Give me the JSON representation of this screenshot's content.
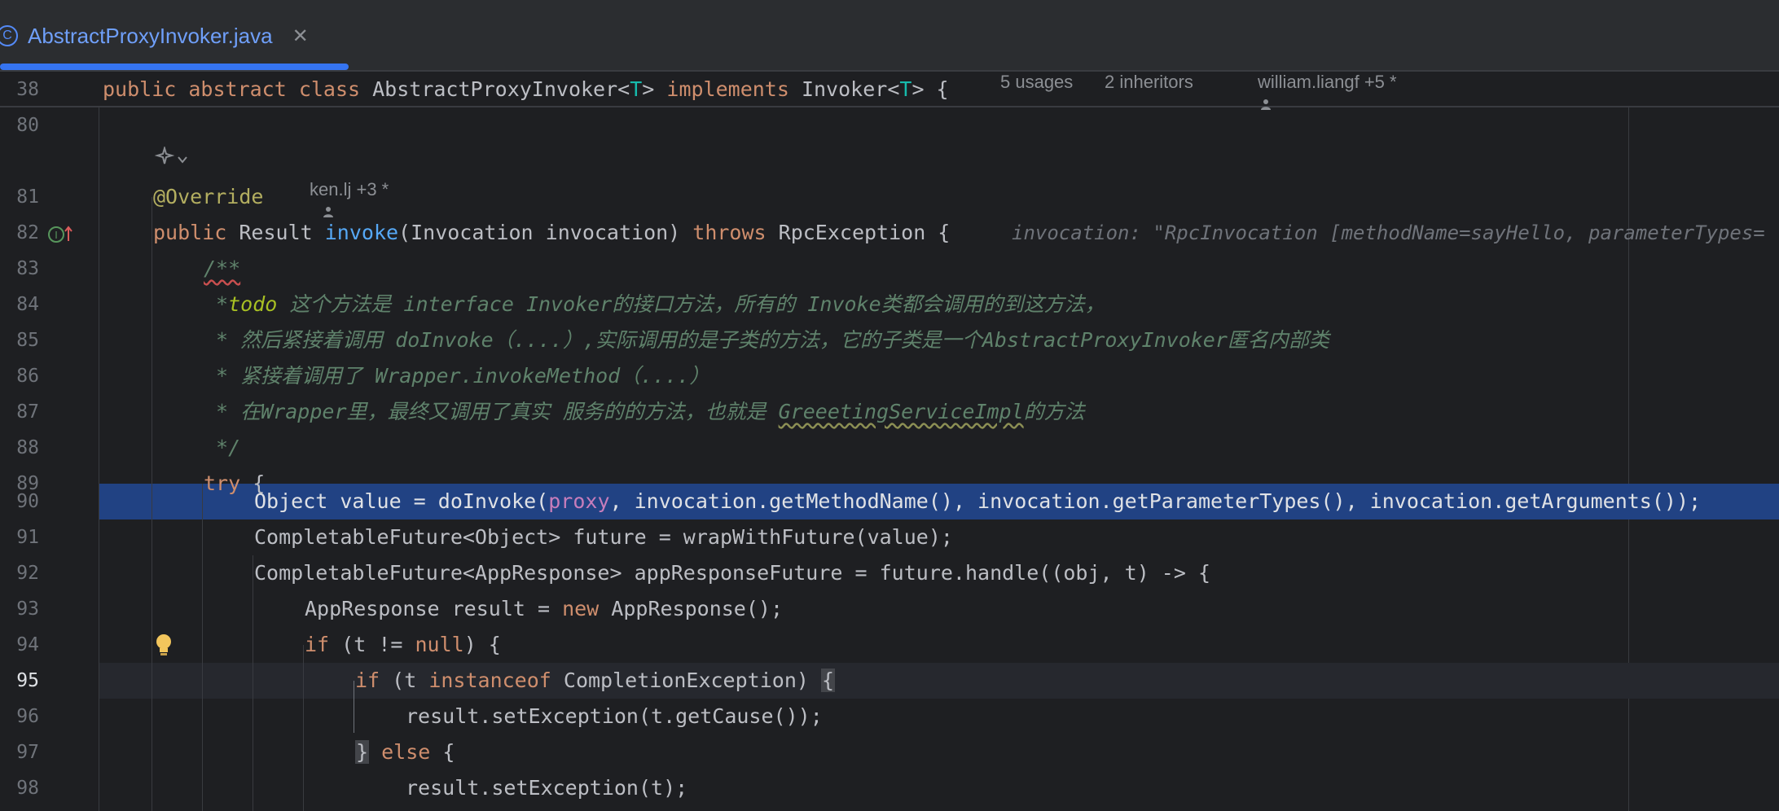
{
  "tab": {
    "file_icon": "class-c-icon",
    "filename": "AbstractProxyInvoker.java",
    "close_glyph": "✕"
  },
  "sticky": {
    "line_no": "38",
    "code": {
      "t1": "public abstract class",
      "t2": " AbstractProxyInvoker<",
      "t3": "T",
      "t4": "> ",
      "t5": "implements",
      "t6": " Invoker<",
      "t7": "T",
      "t8": "> {"
    },
    "usages": "5 usages",
    "inheritors": "2 inheritors",
    "author": "william.liangf +5 *"
  },
  "lines": {
    "l80": "80",
    "l81": "81",
    "l82": "82",
    "l83": "83",
    "l84": "84",
    "l85": "85",
    "l86": "86",
    "l87": "87",
    "l88": "88",
    "l89": "89",
    "l90": "90",
    "l91": "91",
    "l92": "92",
    "l93": "93",
    "l94": "94",
    "l95": "95",
    "l96": "96",
    "l97": "97",
    "l98": "98"
  },
  "code": {
    "c81_anno": "@Override",
    "c81_author": "ken.lj +3 *",
    "c82_a": "public",
    "c82_b": " Result ",
    "c82_c": "invoke",
    "c82_d": "(Invocation invocation) ",
    "c82_e": "throws",
    "c82_f": " RpcException {",
    "c82_hint": "invocation: \"RpcInvocation [methodName=sayHello, parameterTypes=",
    "c83": "/**",
    "c84_a": " *",
    "c84_b": "todo",
    "c84_c": " 这个方法是 interface Invoker的接口方法，所有的 Invoke类都会调用的到这方法，",
    "c85": " * 然后紧接着调用 doInvoke（....）,实际调用的是子类的方法，它的子类是一个AbstractProxyInvoker匿名内部类",
    "c86": " * 紧接着调用了 Wrapper.invokeMethod（....）",
    "c87_a": " * 在Wrapper里，最终又调用了真实 服务的的方法，也就是 ",
    "c87_b": "GreeetingServiceImpl",
    "c87_c": "的方法",
    "c88": " */",
    "c89_a": "try",
    "c89_b": " {",
    "c90_a": "Object value = doInvoke(",
    "c90_b": "proxy",
    "c90_c": ", invocation.getMethodName(), invocation.getParameterTypes(), invocation.getArguments());",
    "c91": "CompletableFuture<Object> future = wrapWithFuture(value);",
    "c92": "CompletableFuture<AppResponse> appResponseFuture = future.handle((obj, t) -> {",
    "c93_a": "AppResponse result = ",
    "c93_b": "new",
    "c93_c": " AppResponse();",
    "c94_a": "if",
    "c94_b": " (t != ",
    "c94_c": "null",
    "c94_d": ") {",
    "c95_a": "if",
    "c95_b": " (t ",
    "c95_c": "instanceof",
    "c95_d": " CompletionException) ",
    "c95_e": "{",
    "c96": "result.setException(t.getCause());",
    "c97_a": "}",
    "c97_b": " else",
    "c97_c": " {",
    "c98": "result.setException(t);"
  },
  "colors": {
    "background": "#1e1f22",
    "keyword": "#cf8e6d",
    "function": "#56a8f5",
    "type_param": "#16baac",
    "annotation": "#b3ae60",
    "doc_comment": "#5f826b",
    "field": "#c77dbb",
    "selection": "#214283",
    "accent": "#3574f0"
  },
  "icons": [
    "class-c-icon",
    "close-icon",
    "ai-sparkle-icon",
    "chevron-down-icon",
    "person-icon",
    "implements-method-icon",
    "lightbulb-icon"
  ]
}
